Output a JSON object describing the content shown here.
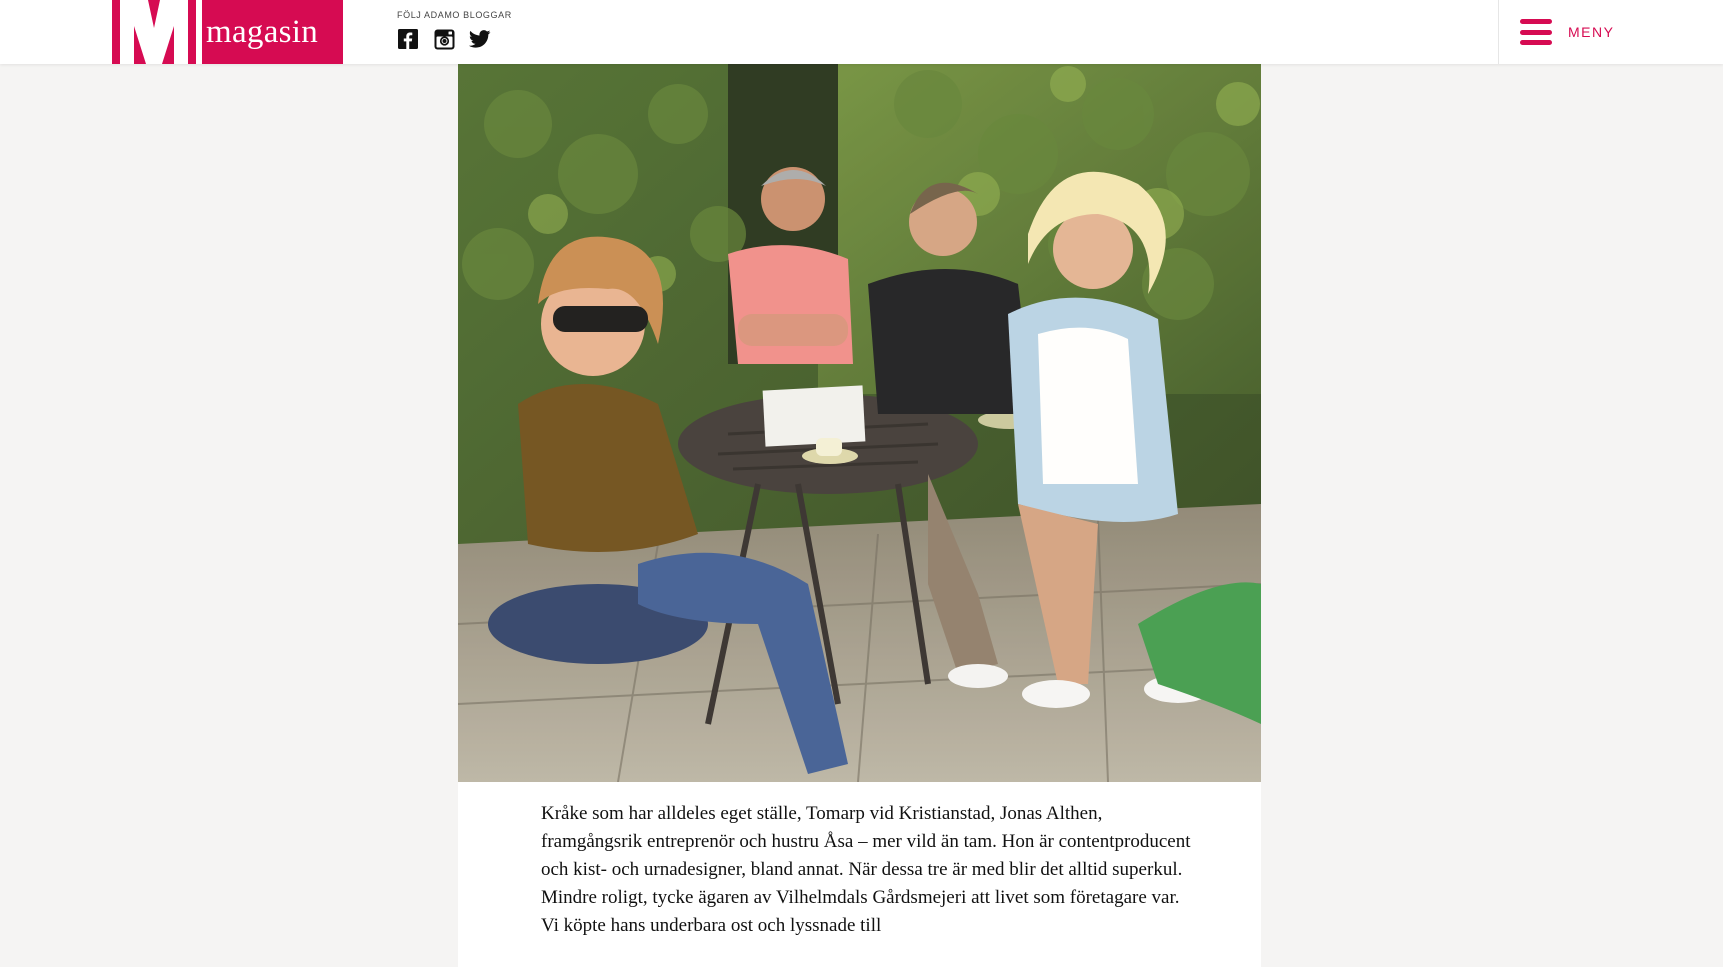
{
  "header": {
    "logo_letter": "M",
    "logo_text": "magasin",
    "follow_label": "FÖLJ ADAMO BLOGGAR",
    "social": [
      {
        "icon": "facebook-icon"
      },
      {
        "icon": "instagram-icon"
      },
      {
        "icon": "twitter-icon"
      }
    ],
    "menu_label": "MENY"
  },
  "colors": {
    "brand": "#d60b52",
    "page_bg": "#f5f4f3",
    "text": "#111111"
  },
  "article": {
    "photo_icon": "garden-cafe-photo",
    "paragraphs": [
      "Kråke som har alldeles eget ställe, Tomarp vid Kristianstad, Jonas Althen, framgångsrik entreprenör och hustru Åsa – mer vild än tam. Hon är contentproducent och kist- och urnadesigner, bland annat. När dessa tre är med blir det alltid superkul.",
      "Mindre roligt, tycke ägaren av Vilhelmdals Gårdsmejeri att livet som företagare var. Vi köpte hans underbara ost och lyssnade till"
    ]
  }
}
